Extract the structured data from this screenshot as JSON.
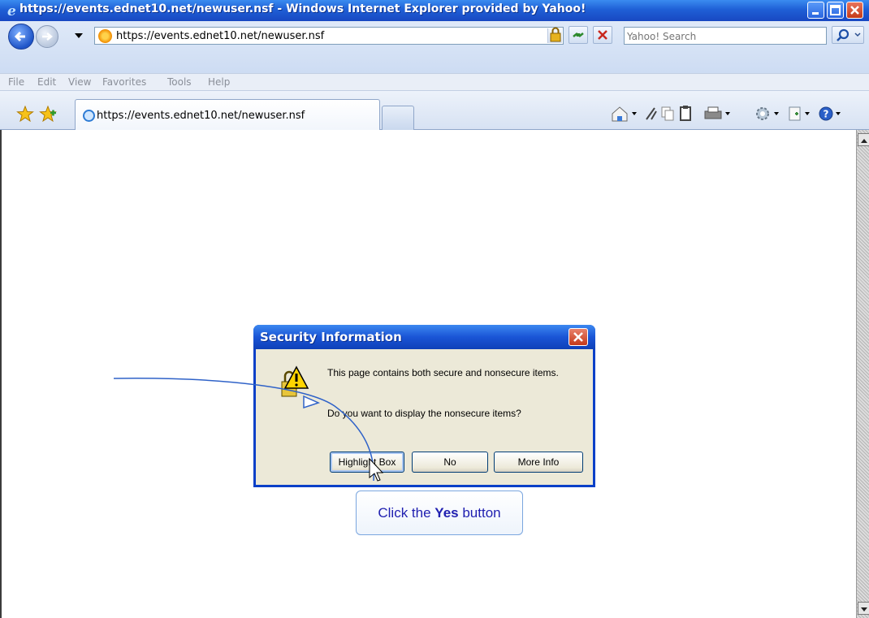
{
  "window": {
    "title": "https://events.ednet10.net/newuser.nsf - Windows Internet Explorer provided by Yahoo!"
  },
  "address_bar": {
    "url": "https://events.ednet10.net/newuser.nsf"
  },
  "search": {
    "placeholder": "Yahoo! Search"
  },
  "menu": {
    "items": [
      "File",
      "Edit",
      "View",
      "Favorites",
      "Tools",
      "Help"
    ]
  },
  "tabs": [
    {
      "title": "https://events.ednet10.net/newuser.nsf"
    }
  ],
  "toolbar_icons": [
    "home-icon",
    "research-icon",
    "copy-icon",
    "paste-icon",
    "print-icon",
    "tools-gear-icon",
    "page-icon",
    "help-icon"
  ],
  "dialog": {
    "title": "Security Information",
    "message_line1": "This page contains both secure and nonsecure items.",
    "message_line2": "Do you want to display the nonsecure items?",
    "buttons": {
      "yes": "Highlight Box",
      "no": "No",
      "more": "More Info"
    }
  },
  "callout": {
    "prefix": "Click the ",
    "bold": "Yes",
    "suffix": " button"
  },
  "colors": {
    "titlebar": "#1f5fd6",
    "dialog_body": "#ece9d8",
    "callout_text": "#1f1fb0"
  }
}
